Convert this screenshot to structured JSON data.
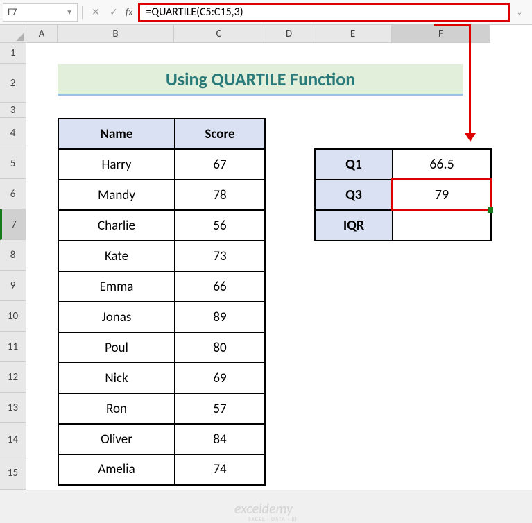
{
  "nameBox": "F7",
  "formula": "=QUARTILE(C5:C15,3)",
  "fx": "fx",
  "columns": [
    "A",
    "B",
    "C",
    "D",
    "E",
    "F"
  ],
  "rows": [
    "1",
    "2",
    "3",
    "4",
    "5",
    "6",
    "7",
    "8",
    "9",
    "10",
    "11",
    "12",
    "13",
    "14",
    "15"
  ],
  "title": "Using QUARTILE Function",
  "headers": {
    "name": "Name",
    "score": "Score"
  },
  "data": [
    {
      "name": "Harry",
      "score": 67
    },
    {
      "name": "Mandy",
      "score": 78
    },
    {
      "name": "Charlie",
      "score": 56
    },
    {
      "name": "Kate",
      "score": 73
    },
    {
      "name": "Emma",
      "score": 66
    },
    {
      "name": "Jonas",
      "score": 89
    },
    {
      "name": "Poul",
      "score": 80
    },
    {
      "name": "Nick",
      "score": 69
    },
    {
      "name": "Ron",
      "score": 57
    },
    {
      "name": "Oliver",
      "score": 84
    },
    {
      "name": "Amelia",
      "score": 74
    }
  ],
  "results": {
    "Q1": {
      "label": "Q1",
      "value": "66.5"
    },
    "Q3": {
      "label": "Q3",
      "value": "79"
    },
    "IQR": {
      "label": "IQR",
      "value": ""
    }
  },
  "watermark": "exceldemy",
  "watermarkSub": "EXCEL · DATA · BI"
}
